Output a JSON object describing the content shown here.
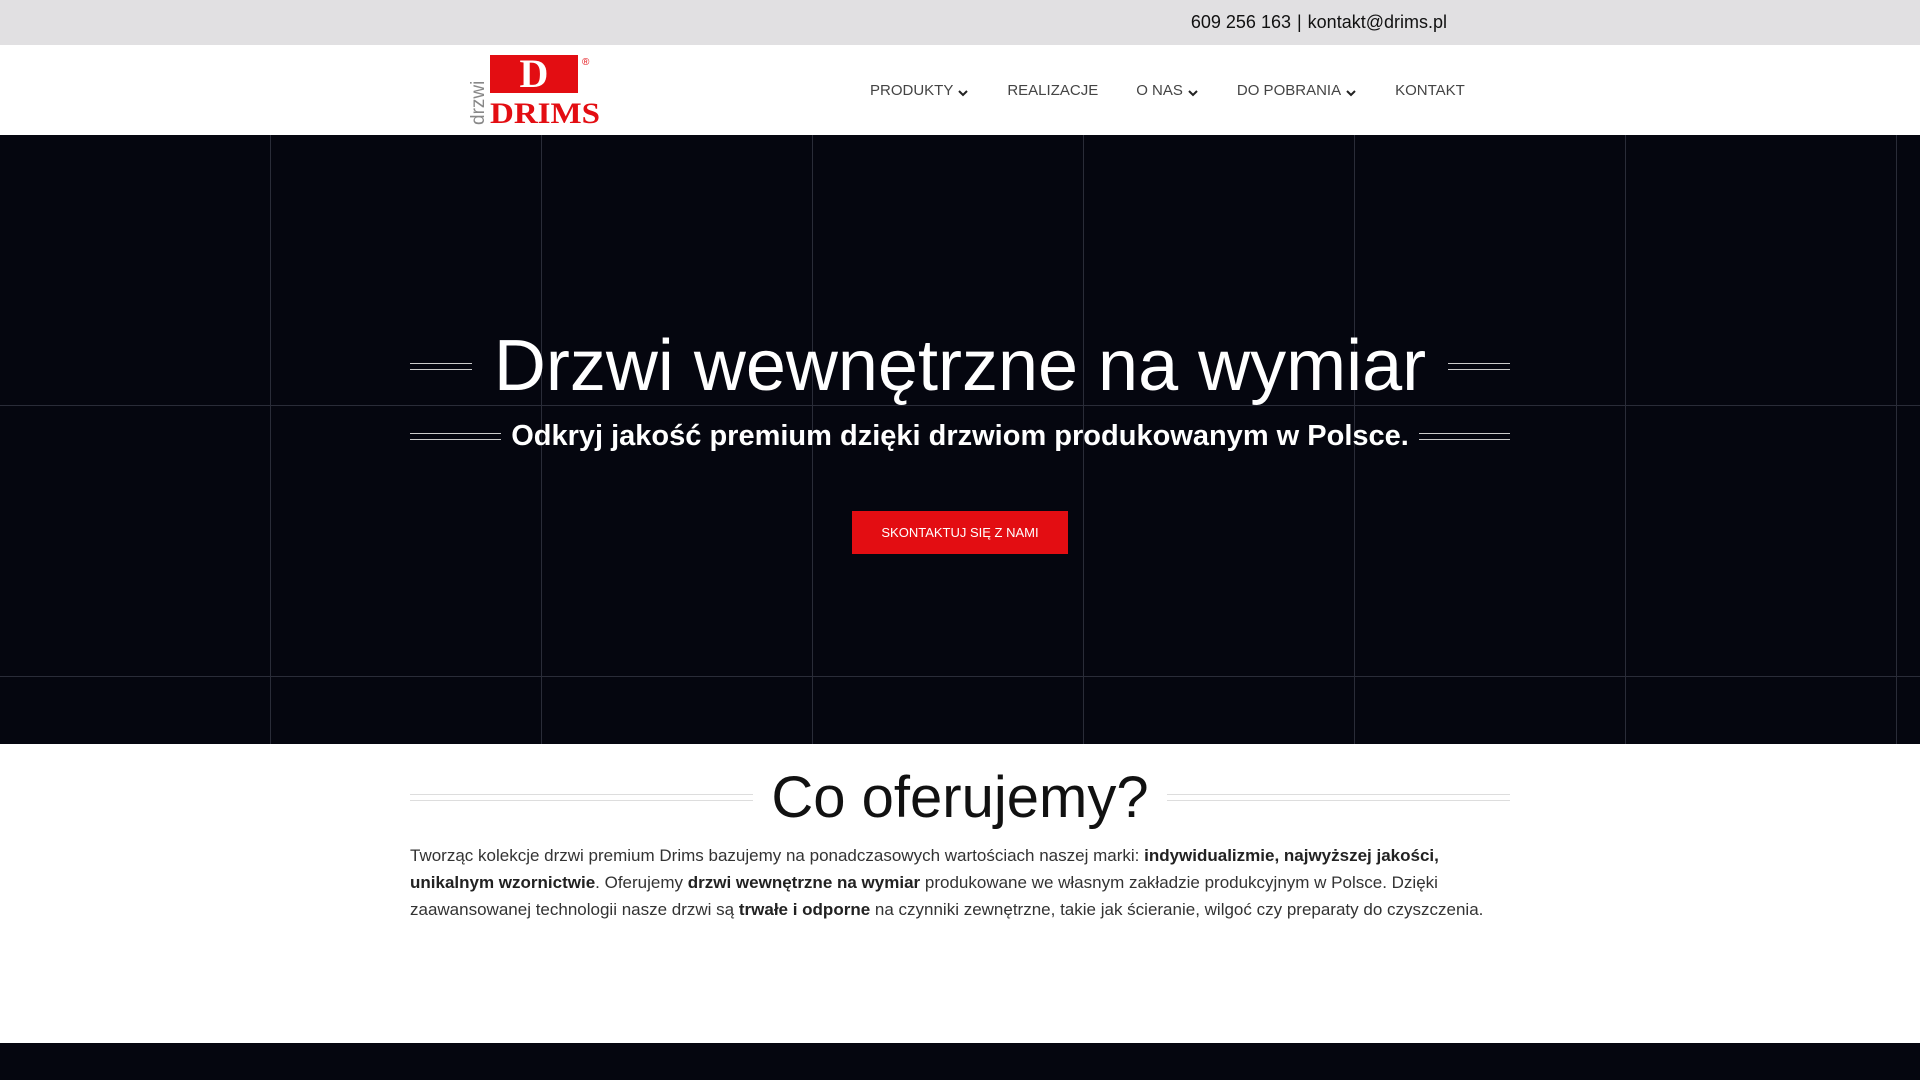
{
  "topbar": {
    "phone": "609 256 163",
    "separator": "|",
    "email": "kontakt@drims.pl"
  },
  "logo": {
    "vertical_text": "drzwi",
    "letter": "D",
    "name": "DRIMS",
    "registered": "®",
    "brand_color": "#e30d12"
  },
  "nav": {
    "items": [
      {
        "label": "PRODUKTY",
        "has_dropdown": true
      },
      {
        "label": "REALIZACJE",
        "has_dropdown": false
      },
      {
        "label": "O NAS",
        "has_dropdown": true
      },
      {
        "label": "DO POBRANIA",
        "has_dropdown": true
      },
      {
        "label": "KONTAKT",
        "has_dropdown": false
      }
    ]
  },
  "hero": {
    "title": "Drzwi wewnętrzne na wymiar",
    "subtitle": "Odkryj jakość premium dzięki drzwiom produkowanym w Polsce.",
    "cta_label": "SKONTAKTUJ SIĘ Z NAMI",
    "background": "#05060f",
    "cta_color": "#e30d12"
  },
  "offer": {
    "title": "Co oferujemy?",
    "p1": "Tworząc kolekcje drzwi premium Drims bazujemy na ponadczasowych wartościach naszej marki: ",
    "b1": "indywidualizmie, najwyższej jakości, unikalnym wzornictwie",
    "p2": ". Oferujemy ",
    "b2": "drzwi wewnętrzne na wymiar",
    "p3": " produkowane we własnym zakładzie produkcyjnym w Polsce. Dzięki zaawansowanej technologii nasze drzwi są ",
    "b3": "trwałe i odporne",
    "p4": " na czynniki zewnętrzne, takie jak ścieranie, wilgoć czy preparaty do czyszczenia."
  }
}
